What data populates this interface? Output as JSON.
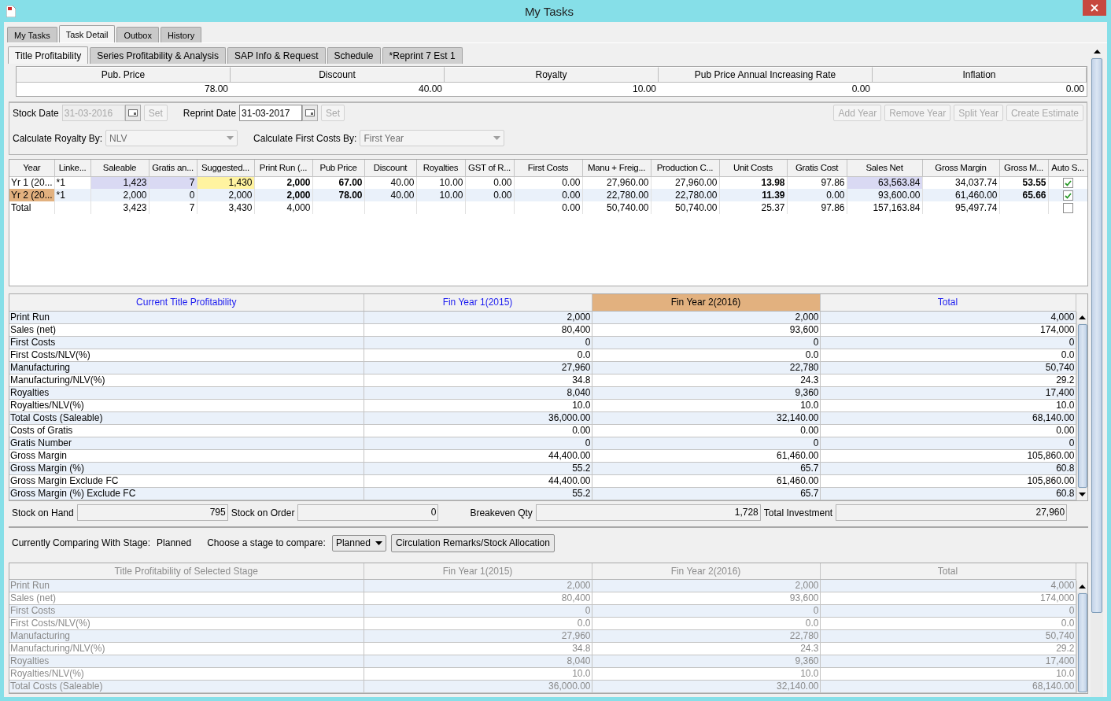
{
  "window": {
    "title": "My Tasks"
  },
  "top_tabs": [
    {
      "label": "My Tasks",
      "selected": false
    },
    {
      "label": "Task Detail",
      "selected": true
    },
    {
      "label": "Outbox",
      "selected": false
    },
    {
      "label": "History",
      "selected": false
    }
  ],
  "detail_tabs": [
    {
      "label": "Title Profitability",
      "selected": true
    },
    {
      "label": "Series Profitability & Analysis",
      "selected": false
    },
    {
      "label": "SAP Info & Request",
      "selected": false
    },
    {
      "label": "Schedule",
      "selected": false
    },
    {
      "label": "*Reprint 7 Est 1",
      "selected": false
    }
  ],
  "parameters": [
    {
      "label": "Pub. Price",
      "value": "78.00"
    },
    {
      "label": "Discount",
      "value": "40.00"
    },
    {
      "label": "Royalty",
      "value": "10.00"
    },
    {
      "label": "Pub Price Annual Increasing Rate",
      "value": "0.00"
    },
    {
      "label": "Inflation",
      "value": "0.00"
    }
  ],
  "dates": [
    {
      "label": "Stock Date",
      "value": "31-03-2016",
      "disabled": true,
      "set_label": "Set",
      "set_disabled": true
    },
    {
      "label": "Reprint Date",
      "value": "31-03-2017",
      "disabled": false,
      "set_label": "Set",
      "set_disabled": true
    }
  ],
  "year_buttons": [
    {
      "label": "Add Year",
      "disabled": true
    },
    {
      "label": "Remove Year",
      "disabled": true
    },
    {
      "label": "Split Year",
      "disabled": true
    },
    {
      "label": "Create Estimate",
      "disabled": true
    }
  ],
  "calc_options": [
    {
      "label": "Calculate Royalty By:",
      "value": "NLV",
      "disabled": true
    },
    {
      "label": "Calculate First Costs By:",
      "value": "First Year",
      "disabled": true
    }
  ],
  "years_table": {
    "columns": [
      {
        "label": "Year",
        "bold": false
      },
      {
        "label": "Linke...",
        "bold": false
      },
      {
        "label": "Saleable",
        "bold": false
      },
      {
        "label": "Gratis an...",
        "bold": false
      },
      {
        "label": "Suggested...",
        "bold": false
      },
      {
        "label": "Print Run (...",
        "bold": true
      },
      {
        "label": "Pub Price",
        "bold": true
      },
      {
        "label": "Discount",
        "bold": false
      },
      {
        "label": "Royalties",
        "bold": false
      },
      {
        "label": "GST of R...",
        "bold": false
      },
      {
        "label": "First Costs",
        "bold": false
      },
      {
        "label": "Manu + Freig...",
        "bold": false
      },
      {
        "label": "Production C...",
        "bold": false
      },
      {
        "label": "Unit Costs",
        "bold": true
      },
      {
        "label": "Gratis Cost",
        "bold": false
      },
      {
        "label": "Sales Net",
        "bold": false
      },
      {
        "label": "Gross Margin",
        "bold": false
      },
      {
        "label": "Gross M...",
        "bold": true
      },
      {
        "label": "Auto S..."
      }
    ],
    "rows": [
      {
        "kind": "year",
        "auto_select": true,
        "cells": [
          "Yr 1 (20...",
          "*1",
          {
            "text": "1,423",
            "color": "#d9d9f3"
          },
          {
            "text": "7",
            "color": "#d9d9f3"
          },
          {
            "text": "1,430",
            "color": "#fff3a0"
          },
          "2,000",
          "67.00",
          "40.00",
          "10.00",
          "0.00",
          "0.00",
          "27,960.00",
          "27,960.00",
          "13.98",
          "97.86",
          {
            "text": "63,563.84",
            "color": "#d9d9f3"
          },
          "34,037.74",
          "53.55"
        ]
      },
      {
        "kind": "year",
        "auto_select": true,
        "cells": [
          {
            "text": "Yr 2 (20...",
            "color": "#e2b17f"
          },
          "*1",
          "2,000",
          "0",
          "2,000",
          "2,000",
          "78.00",
          "40.00",
          "10.00",
          "0.00",
          "0.00",
          "22,780.00",
          "22,780.00",
          "11.39",
          "0.00",
          "93,600.00",
          "61,460.00",
          "65.66"
        ]
      },
      {
        "kind": "total",
        "auto_select": false,
        "cells": [
          "Total",
          "",
          "3,423",
          "7",
          "3,430",
          "4,000",
          "",
          "",
          "",
          "",
          "0.00",
          "50,740.00",
          "50,740.00",
          "25.37",
          "97.86",
          "157,163.84",
          "95,497.74",
          ""
        ]
      }
    ]
  },
  "profitability_table": {
    "disabled": false,
    "columns": [
      {
        "label": "Current Title Profitability",
        "highlighted": false
      },
      {
        "label": "Fin Year 1(2015)",
        "highlighted": false
      },
      {
        "label": "Fin Year 2(2016)",
        "highlighted": true
      },
      {
        "label": "Total",
        "highlighted": false
      }
    ],
    "rows": [
      {
        "label": "Print Run",
        "values": [
          "2,000",
          "2,000",
          "4,000"
        ]
      },
      {
        "label": "Sales (net)",
        "values": [
          "80,400",
          "93,600",
          "174,000"
        ]
      },
      {
        "label": "First Costs",
        "values": [
          "0",
          "0",
          "0"
        ]
      },
      {
        "label": "First Costs/NLV(%)",
        "values": [
          "0.0",
          "0.0",
          "0.0"
        ]
      },
      {
        "label": "Manufacturing",
        "values": [
          "27,960",
          "22,780",
          "50,740"
        ]
      },
      {
        "label": "Manufacturing/NLV(%)",
        "values": [
          "34.8",
          "24.3",
          "29.2"
        ]
      },
      {
        "label": "Royalties",
        "values": [
          "8,040",
          "9,360",
          "17,400"
        ]
      },
      {
        "label": "Royalties/NLV(%)",
        "values": [
          "10.0",
          "10.0",
          "10.0"
        ]
      },
      {
        "label": "Total Costs (Saleable)",
        "values": [
          "36,000.00",
          "32,140.00",
          "68,140.00"
        ]
      },
      {
        "label": "Costs of Gratis",
        "values": [
          "0.00",
          "0.00",
          "0.00"
        ]
      },
      {
        "label": "Gratis Number",
        "values": [
          "0",
          "0",
          "0"
        ]
      },
      {
        "label": "Gross Margin",
        "values": [
          "44,400.00",
          "61,460.00",
          "105,860.00"
        ]
      },
      {
        "label": "Gross Margin (%)",
        "values": [
          "55.2",
          "65.7",
          "60.8"
        ]
      },
      {
        "label": "Gross Margin Exclude FC",
        "values": [
          "44,400.00",
          "61,460.00",
          "105,860.00"
        ]
      },
      {
        "label": "Gross Margin (%) Exclude FC",
        "values": [
          "55.2",
          "65.7",
          "60.8"
        ]
      }
    ]
  },
  "stock_fields": [
    {
      "label": "Stock on Hand",
      "value": "795"
    },
    {
      "label": "Stock on Order",
      "value": "0"
    },
    {
      "label": "Breakeven Qty",
      "value": "1,728"
    },
    {
      "label": "Total Investment",
      "value": "27,960"
    }
  ],
  "comparison": {
    "current_label": "Currently Comparing With Stage:",
    "current_stage": "Planned",
    "choose_label": "Choose a stage to compare:",
    "stage": "Planned",
    "button": "Circulation Remarks/Stock Allocation"
  },
  "stage_table": {
    "disabled": true,
    "columns": [
      {
        "label": "Title Profitability of Selected Stage",
        "highlighted": false
      },
      {
        "label": "Fin Year 1(2015)",
        "highlighted": false
      },
      {
        "label": "Fin Year 2(2016)",
        "highlighted": false
      },
      {
        "label": "Total",
        "highlighted": false
      }
    ],
    "rows": [
      {
        "label": "Print Run",
        "values": [
          "2,000",
          "2,000",
          "4,000"
        ]
      },
      {
        "label": "Sales (net)",
        "values": [
          "80,400",
          "93,600",
          "174,000"
        ]
      },
      {
        "label": "First Costs",
        "values": [
          "0",
          "0",
          "0"
        ]
      },
      {
        "label": "First Costs/NLV(%)",
        "values": [
          "0.0",
          "0.0",
          "0.0"
        ]
      },
      {
        "label": "Manufacturing",
        "values": [
          "27,960",
          "22,780",
          "50,740"
        ]
      },
      {
        "label": "Manufacturing/NLV(%)",
        "values": [
          "34.8",
          "24.3",
          "29.2"
        ]
      },
      {
        "label": "Royalties",
        "values": [
          "8,040",
          "9,360",
          "17,400"
        ]
      },
      {
        "label": "Royalties/NLV(%)",
        "values": [
          "10.0",
          "10.0",
          "10.0"
        ]
      },
      {
        "label": "Total Costs (Saleable)",
        "values": [
          "36,000.00",
          "32,140.00",
          "68,140.00"
        ]
      }
    ]
  }
}
